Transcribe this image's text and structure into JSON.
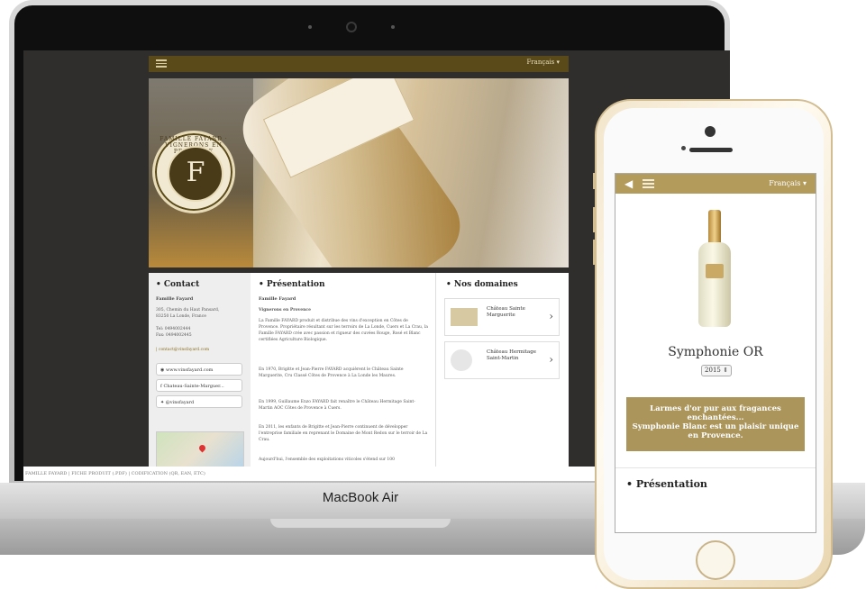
{
  "laptop": {
    "brand": "MacBook Air",
    "site": {
      "language": "Français ▾",
      "seal": {
        "letter": "F",
        "ring_text": "FAMILLE FAYARD · VIGNERONS EN PROVENCE"
      },
      "contact": {
        "heading": "• Contact",
        "name": "Famille Fayard",
        "address1": "305, Chemin du Haut Pansard,",
        "address2": "83250 La Londe, France",
        "tel": "Tel: 0494002444",
        "fax": "Fax: 0494002445",
        "email": "| contact@vinsfayard.com",
        "social": [
          "www.vinsfayard.com",
          "Chateau-Sainte-Marguer...",
          "@vinsfayard"
        ]
      },
      "presentation": {
        "heading": "• Présentation",
        "subtitle": "Famille Fayard",
        "tagline": "Vignerons en Provence",
        "p1": "La Famille FAYARD produit et distribue des vins d'exception en Côtes de Provence. Propriétaire résultant sur les terroirs de La Londe, Cuers et La Crau, la Famille FAYARD crée avec passion et rigueur des cuvées Rouge, Rosé et Blanc certifiées Agriculture Biologique.",
        "p2": "En 1970, Brigitte et Jean-Pierre FAYARD acquièrent le Château Sainte Marguerite, Cru Classé Côtes de Provence à La Londe les Maures.",
        "p3": "En 1999, Guillaume Enzo FAYARD fait renaître le Château Hermitage Saint-Martin AOC Côtes de Provence à Cuers.",
        "p4": "En 2011, les enfants de Brigitte et Jean-Pierre continuent de développer l'entreprise familiale en reprenant le Domaine de Mont Redon sur le terroir de La Crau.",
        "p5": "Aujourd'hui, l'ensemble des exploitations viticoles s'étend sur 100"
      },
      "domaines": {
        "heading": "• Nos domaines",
        "items": [
          {
            "name": "Château Sainte Marguerite"
          },
          {
            "name": "Château Hermitage Saint-Martin"
          }
        ]
      },
      "footer": "FAMILLE FAYARD | FICHE PRODUIT (.PDF) | CODIFICATION (QR, EAN, ETC)"
    }
  },
  "phone": {
    "language": "Français ▾",
    "product_title": "Symphonie OR",
    "year": "2015 ⇕",
    "banner_line1": "Larmes d'or pur aux fragances enchantées...",
    "banner_line2": "Symphonie Blanc est un plaisir unique en Provence.",
    "section": "• Présentation"
  },
  "colors": {
    "brand_dark": "#5a4a1a",
    "brand_gold": "#b39b5c",
    "banner": "#ab955b"
  },
  "icons": [
    "menu-icon",
    "back-arrow-icon",
    "chevron-right-icon",
    "globe-icon",
    "facebook-icon",
    "twitter-icon",
    "map-pin-icon"
  ]
}
